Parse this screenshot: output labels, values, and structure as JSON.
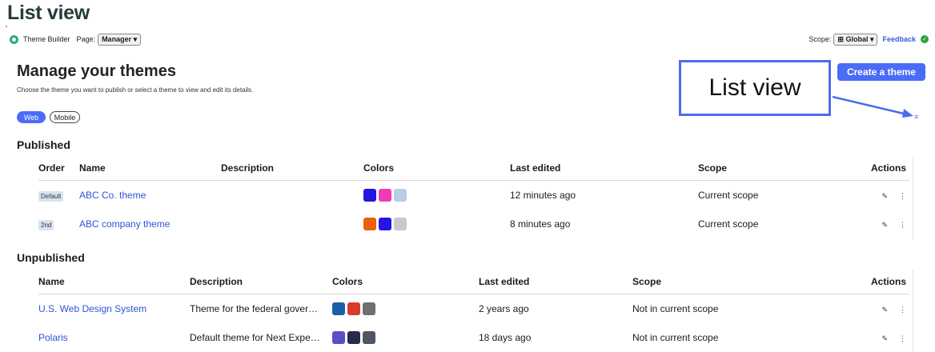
{
  "doc_title": "List view",
  "stray_mark": "`",
  "topbar": {
    "app_name": "Theme Builder",
    "page_label": "Page:",
    "page_value": "Manager ▾",
    "scope_label": "Scope:",
    "scope_value": "⊞ Global ▾",
    "feedback": "Feedback",
    "check_glyph": "✓"
  },
  "heading": "Manage your themes",
  "subheading": "Choose the theme you want to publish or select a theme to view and edit its details.",
  "create_button": "Create a theme",
  "callout_text": "List view",
  "platform_tabs": [
    "Web",
    "Mobile"
  ],
  "list_view_icon": "≡",
  "published": {
    "title": "Published",
    "headers": [
      "Order",
      "Name",
      "Description",
      "Colors",
      "Last edited",
      "Scope",
      "Actions"
    ],
    "rows": [
      {
        "order": "Default",
        "name": "ABC Co. theme",
        "description": "",
        "colors": [
          "#2614e0",
          "#f03bb4",
          "#b9cde4"
        ],
        "last_edited": "12 minutes ago",
        "scope": "Current scope"
      },
      {
        "order": "2nd",
        "name": "ABC company theme",
        "description": "",
        "colors": [
          "#e8620a",
          "#2614e0",
          "#c8c8c8"
        ],
        "last_edited": "8 minutes ago",
        "scope": "Current scope"
      }
    ]
  },
  "unpublished": {
    "title": "Unpublished",
    "headers": [
      "Name",
      "Description",
      "Colors",
      "Last edited",
      "Scope",
      "Actions"
    ],
    "rows": [
      {
        "name": "U.S. Web Design System",
        "description": "Theme for the federal gover…",
        "colors": [
          "#1a5ea8",
          "#d83a2b",
          "#6e6e6e"
        ],
        "last_edited": "2 years ago",
        "scope": "Not in current scope"
      },
      {
        "name": "Polaris",
        "description": "Default theme for Next Expe…",
        "colors": [
          "#5a4fc6",
          "#2a2a4a",
          "#4d5662"
        ],
        "last_edited": "18 days ago",
        "scope": "Not in current scope"
      }
    ]
  },
  "actions": {
    "edit_icon": "✎",
    "more_icon": "⋮"
  }
}
